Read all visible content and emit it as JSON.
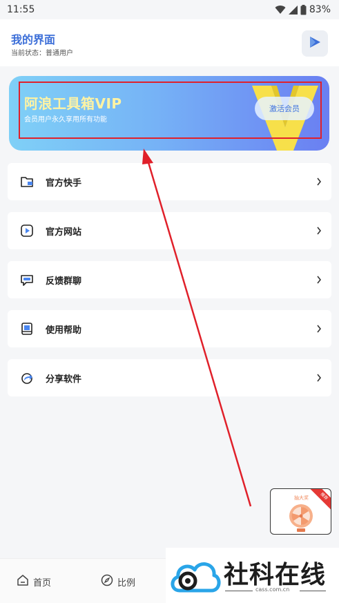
{
  "status_bar": {
    "time": "11:55",
    "battery": "83%"
  },
  "header": {
    "title": "我的界面",
    "subtitle": "当前状态：普通用户"
  },
  "vip_banner": {
    "title": "阿浪工具箱VIP",
    "description": "会员用户永久享用所有功能",
    "button_label": "激活会员"
  },
  "menu": {
    "items": [
      {
        "label": "官方快手",
        "icon": "folder-icon"
      },
      {
        "label": "官方网站",
        "icon": "play-circle-icon"
      },
      {
        "label": "反馈群聊",
        "icon": "chat-icon"
      },
      {
        "label": "使用帮助",
        "icon": "book-icon"
      },
      {
        "label": "分享软件",
        "icon": "share-icon"
      }
    ]
  },
  "float_card": {
    "title": "抽大奖",
    "ribbon": "推荐"
  },
  "bottom_nav": {
    "items": [
      {
        "label": "首页",
        "icon": "home-icon"
      },
      {
        "label": "比例",
        "icon": "compass-icon"
      }
    ]
  },
  "watermark": {
    "brand": "社科在线",
    "url": "cass.com.cn"
  },
  "colors": {
    "accent": "#3d6fd8",
    "annotation": "#e0202a",
    "vip_text": "#fff3a3"
  }
}
